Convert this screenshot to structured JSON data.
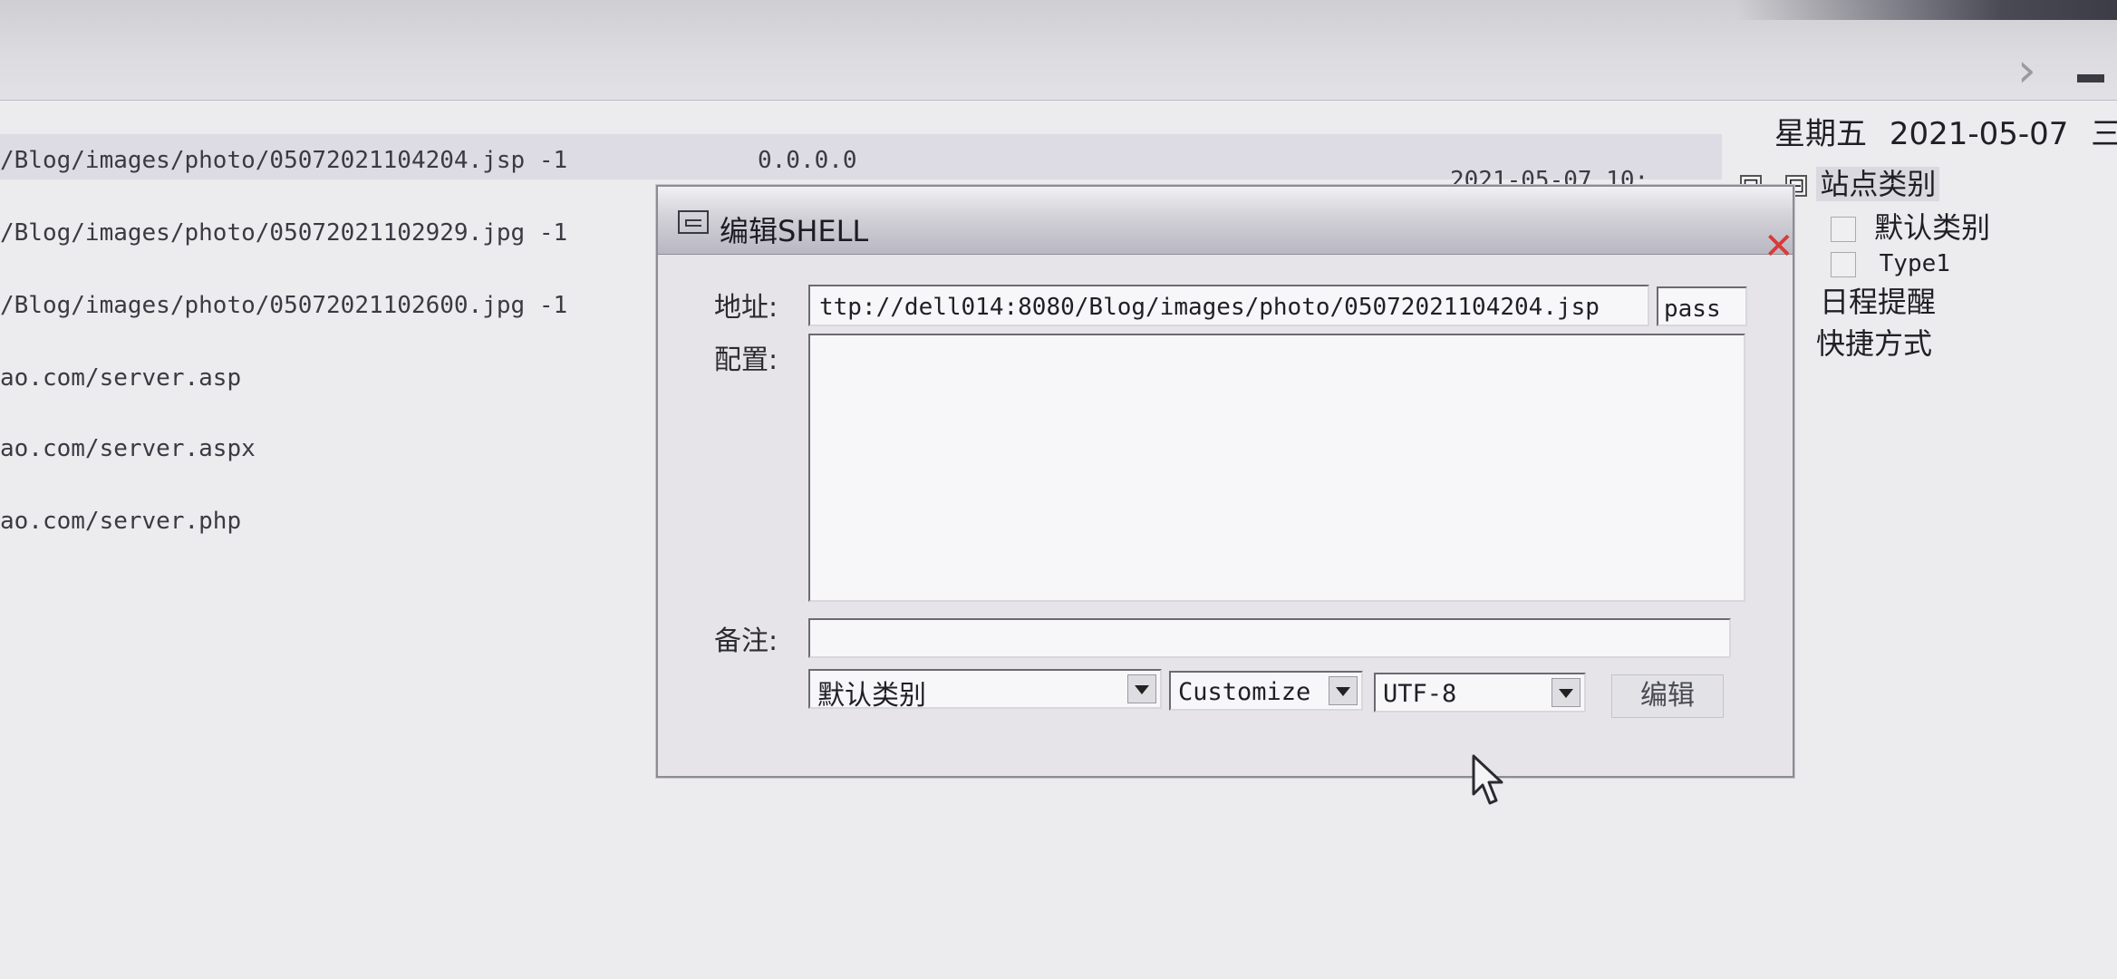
{
  "header": {
    "weekday": "星期五",
    "date": "2021-05-07",
    "lunar": "三月廿"
  },
  "list": {
    "rows": [
      {
        "url": "/Blog/images/photo/05072021104204.jsp  -1",
        "ip": "0.0.0.0",
        "time": "2021-05-07 10:..."
      },
      {
        "url": "/Blog/images/photo/05072021102929.jpg  -1"
      },
      {
        "url": "/Blog/images/photo/05072021102600.jpg  -1"
      },
      {
        "url": "ao.com/server.asp"
      },
      {
        "url": "ao.com/server.aspx"
      },
      {
        "url": "ao.com/server.php"
      }
    ]
  },
  "tree": {
    "collapse_glyph": "⊟",
    "root_glyph": "⊟",
    "root": "站点类别",
    "children": [
      "默认类别",
      "Type1"
    ],
    "items": [
      "日程提醒",
      "快捷方式"
    ]
  },
  "dialog": {
    "title": "编辑SHELL",
    "close_glyph": "✕",
    "address_label": "地址:",
    "address_value": "ttp://dell014:8080/Blog/images/photo/05072021104204.jsp",
    "password_value": "pass",
    "config_label": "配置:",
    "config_value": "",
    "note_label": "备注:",
    "note_value": "",
    "category_value": "默认类别",
    "type_value": "Customize",
    "encoding_value": "UTF-8",
    "edit_button": "编辑"
  }
}
